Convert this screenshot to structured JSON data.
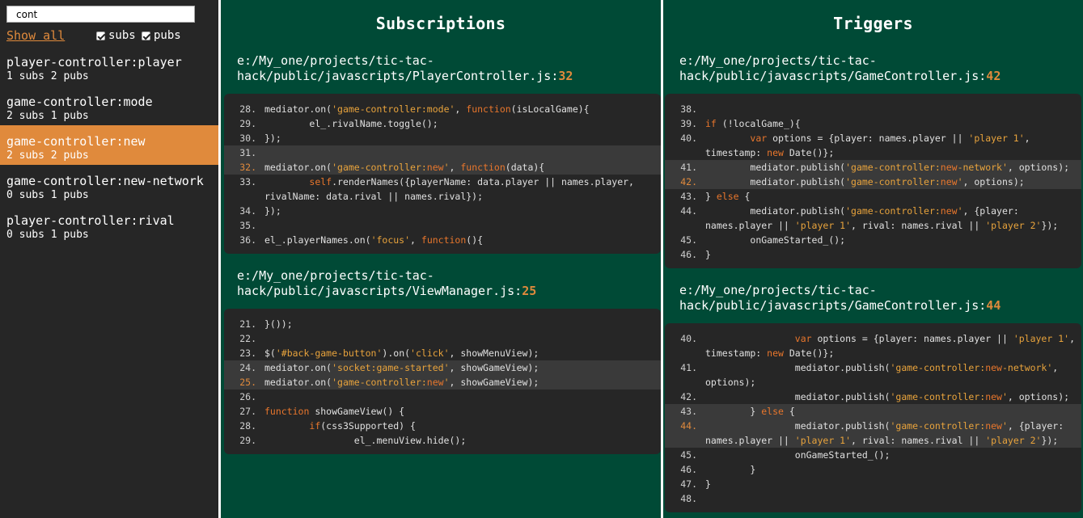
{
  "sidebar": {
    "search_value": "cont",
    "show_all": "Show all",
    "filter_subs": "subs",
    "filter_pubs": "pubs",
    "events": [
      {
        "name": "player-controller:player",
        "counts": "1 subs 2 pubs",
        "active": false
      },
      {
        "name": "game-controller:mode",
        "counts": "2 subs 1 pubs",
        "active": false
      },
      {
        "name": "game-controller:new",
        "counts": "2 subs 2 pubs",
        "active": true
      },
      {
        "name": "game-controller:new-network",
        "counts": "0 subs 1 pubs",
        "active": false
      },
      {
        "name": "player-controller:rival",
        "counts": "0 subs 1 pubs",
        "active": false
      }
    ]
  },
  "subscriptions": {
    "title": "Subscriptions",
    "files": [
      {
        "path": "e:/My_one/projects/tic-tac-hack/public/javascripts/PlayerController.js:",
        "line": "32",
        "lines": [
          {
            "n": "28.",
            "code": "mediator.on('game-controller:mode', function(isLocalGame){",
            "hl": false,
            "target": false
          },
          {
            "n": "29.",
            "code": "        el_.rivalName.toggle();",
            "hl": false,
            "target": false
          },
          {
            "n": "30.",
            "code": "});",
            "hl": false,
            "target": false
          },
          {
            "n": "31.",
            "code": "",
            "hl": true,
            "target": false
          },
          {
            "n": "32.",
            "code": "mediator.on('game-controller:new', function(data){",
            "hl": true,
            "target": true
          },
          {
            "n": "33.",
            "code": "        self.renderNames({playerName: data.player || names.player, rivalName: data.rival || names.rival});",
            "hl": false,
            "target": false
          },
          {
            "n": "34.",
            "code": "});",
            "hl": false,
            "target": false
          },
          {
            "n": "35.",
            "code": "",
            "hl": false,
            "target": false
          },
          {
            "n": "36.",
            "code": "el_.playerNames.on('focus', function(){",
            "hl": false,
            "target": false
          }
        ]
      },
      {
        "path": "e:/My_one/projects/tic-tac-hack/public/javascripts/ViewManager.js:",
        "line": "25",
        "lines": [
          {
            "n": "21.",
            "code": "}());",
            "hl": false,
            "target": false
          },
          {
            "n": "22.",
            "code": "",
            "hl": false,
            "target": false
          },
          {
            "n": "23.",
            "code": "$('#back-game-button').on('click', showMenuView);",
            "hl": false,
            "target": false
          },
          {
            "n": "24.",
            "code": "mediator.on('socket:game-started', showGameView);",
            "hl": true,
            "target": false
          },
          {
            "n": "25.",
            "code": "mediator.on('game-controller:new', showGameView);",
            "hl": true,
            "target": true
          },
          {
            "n": "26.",
            "code": "",
            "hl": false,
            "target": false
          },
          {
            "n": "27.",
            "code": "function showGameView() {",
            "hl": false,
            "target": false
          },
          {
            "n": "28.",
            "code": "        if(css3Supported) {",
            "hl": false,
            "target": false
          },
          {
            "n": "29.",
            "code": "                el_.menuView.hide();",
            "hl": false,
            "target": false
          }
        ]
      }
    ]
  },
  "triggers": {
    "title": "Triggers",
    "files": [
      {
        "path": "e:/My_one/projects/tic-tac-hack/public/javascripts/GameController.js:",
        "line": "42",
        "lines": [
          {
            "n": "38.",
            "code": "",
            "hl": false,
            "target": false
          },
          {
            "n": "39.",
            "code": "if (!localGame_){",
            "hl": false,
            "target": false
          },
          {
            "n": "40.",
            "code": "        var options = {player: names.player || 'player 1', timestamp: new Date()};",
            "hl": false,
            "target": false
          },
          {
            "n": "41.",
            "code": "        mediator.publish('game-controller:new-network', options);",
            "hl": true,
            "target": false
          },
          {
            "n": "42.",
            "code": "        mediator.publish('game-controller:new', options);",
            "hl": true,
            "target": true
          },
          {
            "n": "43.",
            "code": "} else {",
            "hl": false,
            "target": false
          },
          {
            "n": "44.",
            "code": "        mediator.publish('game-controller:new', {player: names.player || 'player 1', rival: names.rival || 'player 2'});",
            "hl": false,
            "target": false
          },
          {
            "n": "45.",
            "code": "        onGameStarted_();",
            "hl": false,
            "target": false
          },
          {
            "n": "46.",
            "code": "}",
            "hl": false,
            "target": false
          }
        ]
      },
      {
        "path": "e:/My_one/projects/tic-tac-hack/public/javascripts/GameController.js:",
        "line": "44",
        "lines": [
          {
            "n": "40.",
            "code": "                var options = {player: names.player || 'player 1', timestamp: new Date()};",
            "hl": false,
            "target": false
          },
          {
            "n": "41.",
            "code": "                mediator.publish('game-controller:new-network', options);",
            "hl": false,
            "target": false
          },
          {
            "n": "42.",
            "code": "                mediator.publish('game-controller:new', options);",
            "hl": false,
            "target": false
          },
          {
            "n": "43.",
            "code": "        } else {",
            "hl": true,
            "target": false
          },
          {
            "n": "44.",
            "code": "                mediator.publish('game-controller:new', {player: names.player || 'player 1', rival: names.rival || 'player 2'});",
            "hl": true,
            "target": true
          },
          {
            "n": "45.",
            "code": "                onGameStarted_();",
            "hl": false,
            "target": false
          },
          {
            "n": "46.",
            "code": "        }",
            "hl": false,
            "target": false
          },
          {
            "n": "47.",
            "code": "}",
            "hl": false,
            "target": false
          },
          {
            "n": "48.",
            "code": "",
            "hl": false,
            "target": false
          }
        ]
      }
    ]
  },
  "colors": {
    "accent": "#e08a3c",
    "sidebar_bg": "#262626",
    "panel_bg": "#004a36",
    "code_bg": "#262626"
  }
}
